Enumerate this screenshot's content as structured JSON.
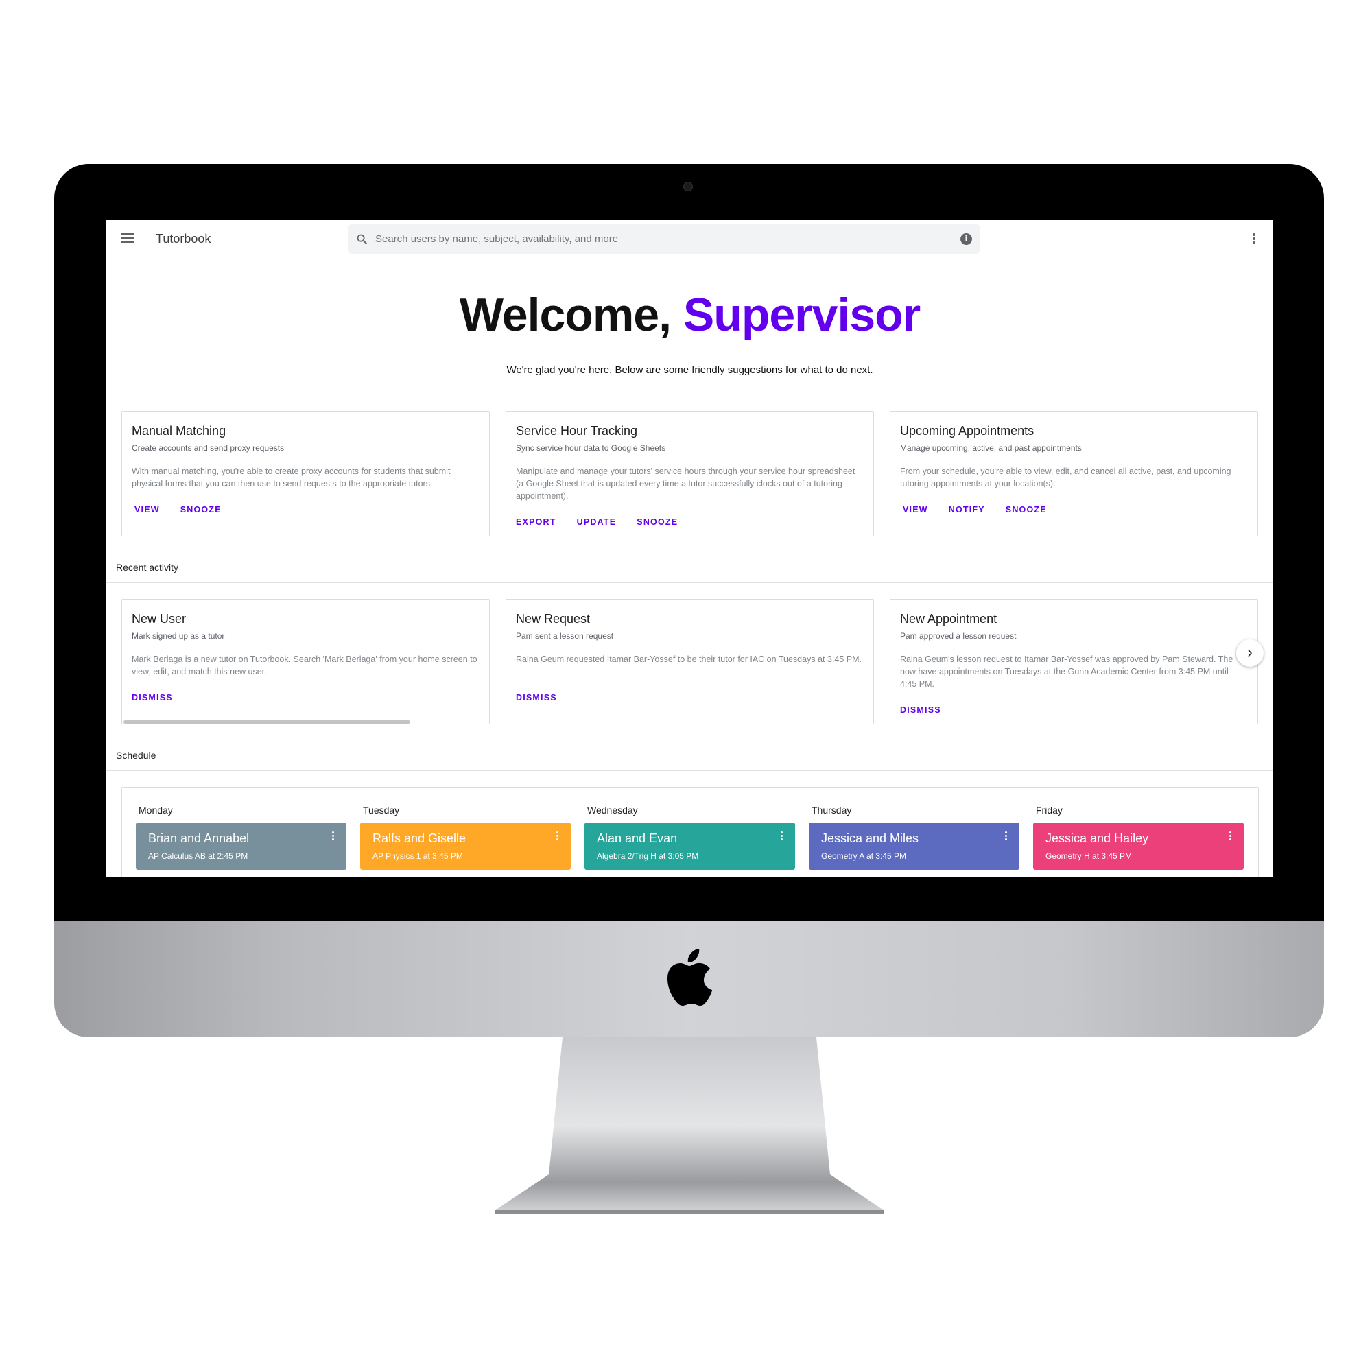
{
  "topbar": {
    "app_title": "Tutorbook",
    "search_placeholder": "Search users by name, subject, availability, and more"
  },
  "hero": {
    "welcome_prefix": "Welcome, ",
    "welcome_name": "Supervisor",
    "subtitle": "We're glad you're here. Below are some friendly suggestions for what to do next.",
    "accent_color": "#6200ee"
  },
  "suggestions": [
    {
      "title": "Manual Matching",
      "subtitle": "Create accounts and send proxy requests",
      "body": "With manual matching, you're able to create proxy accounts for students that submit physical forms that you can then use to send requests to the appropriate tutors.",
      "actions": [
        "VIEW",
        "SNOOZE"
      ]
    },
    {
      "title": "Service Hour Tracking",
      "subtitle": "Sync service hour data to Google Sheets",
      "body": "Manipulate and manage your tutors' service hours through your service hour spreadsheet (a Google Sheet that is updated every time a tutor successfully clocks out of a tutoring appointment).",
      "actions": [
        "EXPORT",
        "UPDATE",
        "SNOOZE"
      ]
    },
    {
      "title": "Upcoming Appointments",
      "subtitle": "Manage upcoming, active, and past appointments",
      "body": "From your schedule, you're able to view, edit, and cancel all active, past, and upcoming tutoring appointments at your location(s).",
      "actions": [
        "VIEW",
        "NOTIFY",
        "SNOOZE"
      ]
    }
  ],
  "recent_activity": {
    "label": "Recent activity",
    "items": [
      {
        "title": "New User",
        "subtitle": "Mark signed up as a tutor",
        "body": "Mark Berlaga is a new tutor on Tutorbook. Search 'Mark Berlaga' from your home screen to view, edit, and match this new user.",
        "action": "DISMISS"
      },
      {
        "title": "New Request",
        "subtitle": "Pam sent a lesson request",
        "body": "Raina Geum requested Itamar Bar-Yossef to be their tutor for IAC on Tuesdays at 3:45 PM.",
        "action": "DISMISS"
      },
      {
        "title": "New Appointment",
        "subtitle": "Pam approved a lesson request",
        "body": "Raina Geum's lesson request to Itamar Bar-Yossef was approved by Pam Steward. The now have appointments on Tuesdays at the Gunn Academic Center from 3:45 PM until 4:45 PM.",
        "action": "DISMISS"
      }
    ]
  },
  "schedule": {
    "label": "Schedule",
    "days": [
      {
        "day": "Monday",
        "title": "Brian and Annabel",
        "subtitle": "AP Calculus AB at 2:45 PM",
        "color": "#78909c",
        "next_color": "#b0bec5"
      },
      {
        "day": "Tuesday",
        "title": "Ralfs and Giselle",
        "subtitle": "AP Physics 1 at 3:45 PM",
        "color": "#ffa726",
        "next_color": "#ff8a65"
      },
      {
        "day": "Wednesday",
        "title": "Alan and Evan",
        "subtitle": "Algebra 2/Trig H at 3:05 PM",
        "color": "#26a69a",
        "next_color": "#4db6ac"
      },
      {
        "day": "Thursday",
        "title": "Jessica and Miles",
        "subtitle": "Geometry A at 3:45 PM",
        "color": "#5c6bc0",
        "next_color": "#7986cb"
      },
      {
        "day": "Friday",
        "title": "Jessica and Hailey",
        "subtitle": "Geometry H at 3:45 PM",
        "color": "#ec407a",
        "next_color": "#f06292"
      }
    ]
  },
  "icons": {
    "menu": "menu-icon",
    "search": "search-icon",
    "info": "info-icon",
    "more": "more-vert-icon",
    "next": "chevron-right-icon",
    "camera": "camera-icon",
    "brand": "apple-logo-icon"
  }
}
